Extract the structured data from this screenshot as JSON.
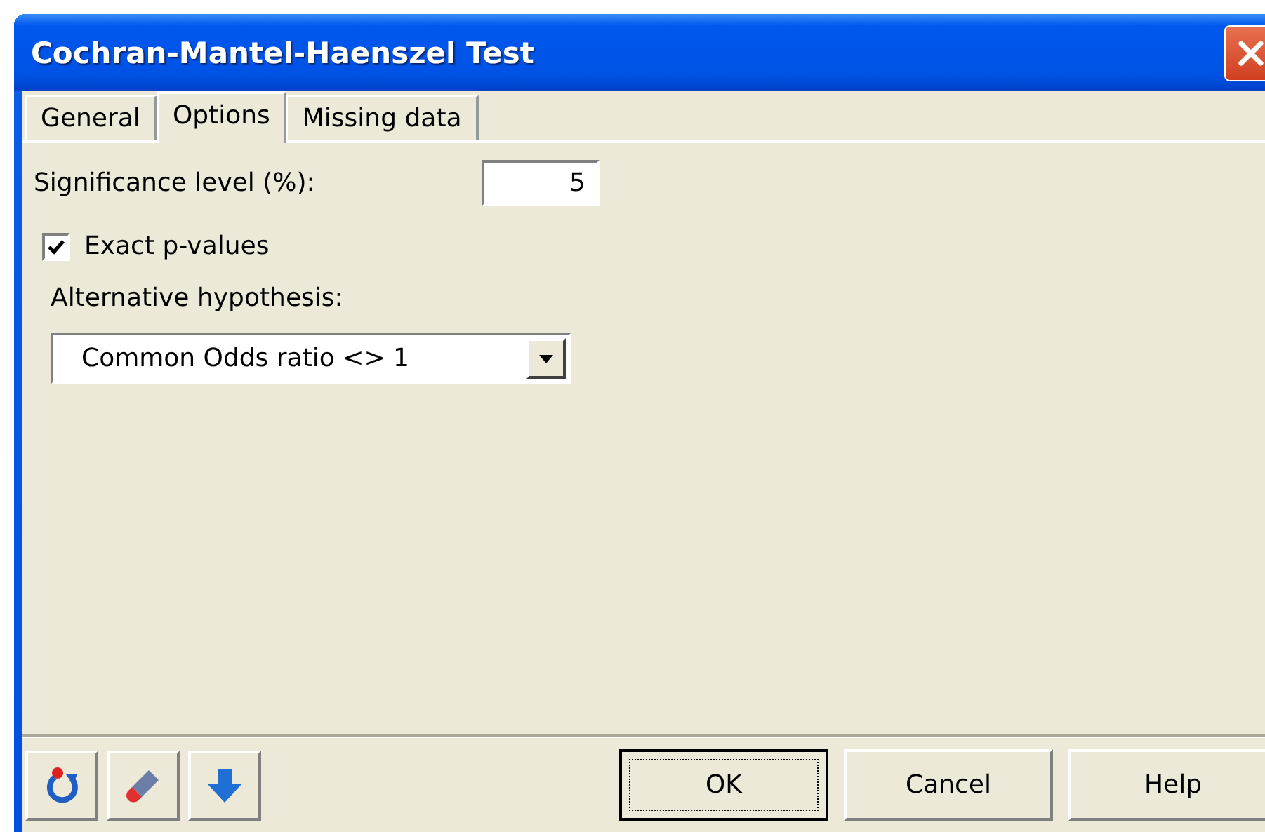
{
  "window": {
    "title": "Cochran-Mantel-Haenszel Test"
  },
  "tabs": [
    {
      "label": "General",
      "selected": false
    },
    {
      "label": "Options",
      "selected": true
    },
    {
      "label": "Missing data",
      "selected": false
    }
  ],
  "significance": {
    "label": "Significance level (%):",
    "value": "5"
  },
  "exact_p_values": {
    "label": "Exact p-values",
    "checked": true
  },
  "alternative_hypothesis": {
    "label": "Alternative hypothesis:",
    "value": "Common Odds ratio <> 1"
  },
  "tool_buttons": [
    {
      "kind": "reset"
    },
    {
      "kind": "eraser"
    },
    {
      "kind": "down"
    }
  ],
  "buttons": [
    {
      "label": "OK",
      "default": true
    },
    {
      "label": "Cancel",
      "default": false
    },
    {
      "label": "Help",
      "default": false
    }
  ]
}
